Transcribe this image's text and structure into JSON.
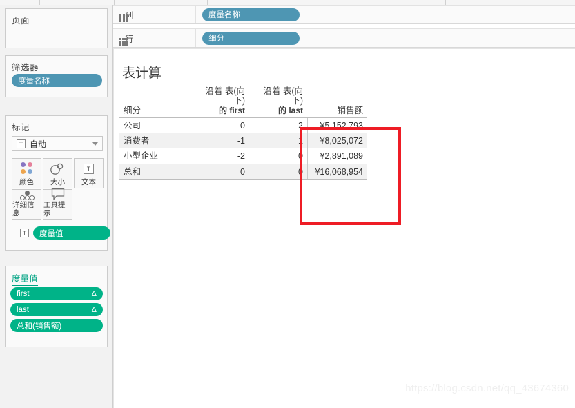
{
  "sidebar": {
    "pages": {
      "title": "页面"
    },
    "filters": {
      "title": "筛选器",
      "pills": [
        {
          "label": "度量名称",
          "color": "#4e96b3"
        }
      ]
    },
    "marks": {
      "title": "标记",
      "mark_type": {
        "label": "自动",
        "icon": "text-mark-icon"
      },
      "buttons": [
        {
          "label": "颜色",
          "icon": "color-dots-icon"
        },
        {
          "label": "大小",
          "icon": "size-circles-icon"
        },
        {
          "label": "文本",
          "icon": "text-box-icon"
        },
        {
          "label": "详细信息",
          "icon": "detail-dots-icon"
        },
        {
          "label": "工具提示",
          "icon": "tooltip-bubble-icon"
        }
      ],
      "pill": {
        "label": "度量值",
        "color": "#00b388",
        "prefix_icon": "text-mark-icon"
      }
    },
    "measure_values": {
      "title": "度量值",
      "pills": [
        {
          "label": "first",
          "suffix": "Δ",
          "color": "#00b388"
        },
        {
          "label": "last",
          "suffix": "Δ",
          "color": "#00b388"
        },
        {
          "label": "总和(销售额)",
          "suffix": "",
          "color": "#00b388"
        }
      ]
    }
  },
  "shelves": {
    "columns": {
      "label": "列",
      "icon": "columns-icon",
      "pills": [
        {
          "label": "度量名称",
          "color": "#4e96b3"
        }
      ]
    },
    "rows": {
      "label": "行",
      "icon": "rows-icon",
      "pills": [
        {
          "label": "细分",
          "color": "#4e96b3"
        }
      ]
    }
  },
  "worksheet": {
    "title": "表计算",
    "table": {
      "dimension_header": "细分",
      "column_headers": [
        {
          "line1": "沿着 表(向下)",
          "line2": "的 first"
        },
        {
          "line1": "沿着 表(向下)",
          "line2": "的 last"
        },
        {
          "line1": "",
          "line2": "销售额"
        }
      ],
      "rows": [
        {
          "dimension": "公司",
          "first": "0",
          "last": "2",
          "sales": "¥5,152,793"
        },
        {
          "dimension": "消费者",
          "first": "-1",
          "last": "1",
          "sales": "¥8,025,072"
        },
        {
          "dimension": "小型企业",
          "first": "-2",
          "last": "0",
          "sales": "¥2,891,089"
        },
        {
          "dimension": "总和",
          "first": "0",
          "last": "0",
          "sales": "¥16,068,954"
        }
      ]
    },
    "annotation": {
      "name": "red-highlight-rectangle",
      "color": "#ee1c25"
    },
    "watermark": "https://blog.csdn.net/qq_43674360"
  }
}
